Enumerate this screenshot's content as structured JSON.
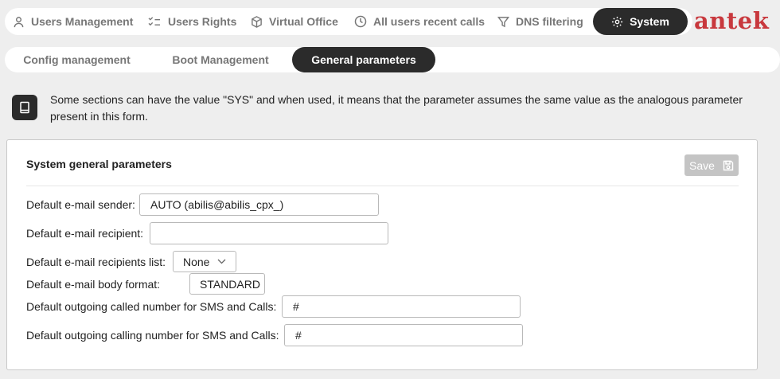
{
  "nav": {
    "items": [
      {
        "label": "Users Management",
        "icon": "user-icon"
      },
      {
        "label": "Users Rights",
        "icon": "checklist-icon"
      },
      {
        "label": "Virtual Office",
        "icon": "cube-icon"
      },
      {
        "label": "All users recent calls",
        "icon": "clock-icon"
      },
      {
        "label": "DNS filtering",
        "icon": "filter-icon"
      },
      {
        "label": "System",
        "icon": "gear-icon"
      }
    ],
    "brand": "antek",
    "brand_color": "#c8383d"
  },
  "subtabs": [
    {
      "label": "Config management"
    },
    {
      "label": "Boot Management"
    },
    {
      "label": "General parameters"
    }
  ],
  "notice": {
    "icon": "book-icon",
    "text": "Some sections can have the value \"SYS\" and when used, it means that the parameter assumes the same value as the analogous parameter present in this form."
  },
  "panel": {
    "title": "System general parameters",
    "save_label": "Save",
    "fields": {
      "sender": {
        "label": "Default e-mail sender:",
        "value": "AUTO (abilis@abilis_cpx_)"
      },
      "recipient": {
        "label": "Default e-mail recipient:",
        "value": ""
      },
      "recipients_list": {
        "label": "Default e-mail recipients list:",
        "value": "None"
      },
      "body_format": {
        "label": "Default e-mail body format:",
        "value": "STANDARD"
      },
      "called": {
        "label": "Default outgoing called number for SMS and Calls:",
        "value": "#"
      },
      "calling": {
        "label": "Default outgoing calling number for SMS and Calls:",
        "value": "#"
      }
    }
  }
}
